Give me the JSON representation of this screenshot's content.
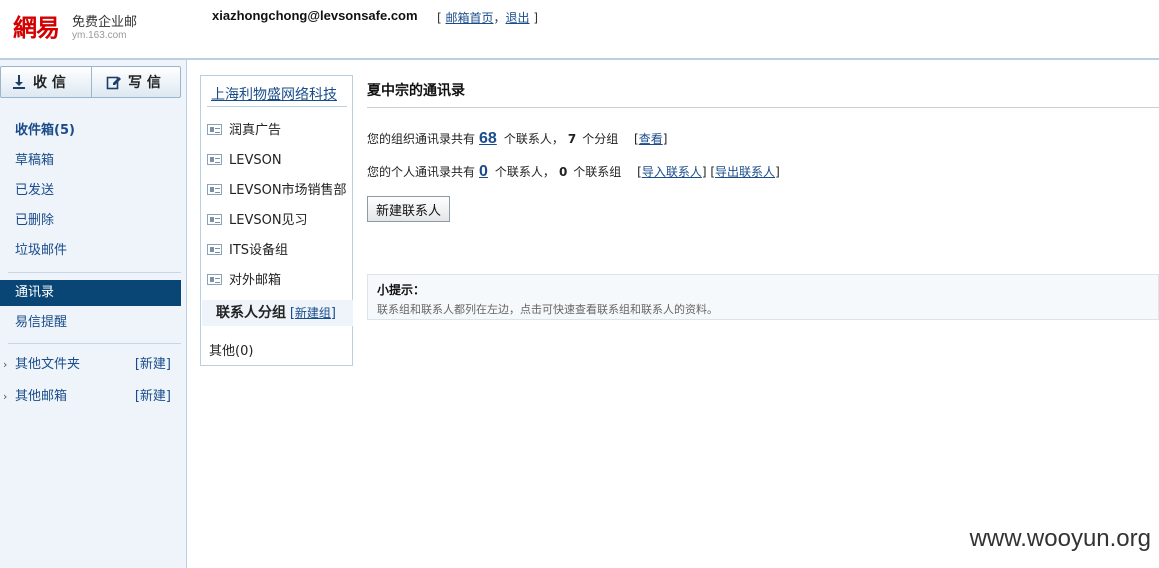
{
  "header": {
    "logo_glyph": "網易",
    "logo_name": "免费企业邮",
    "logo_domain": "ym.163.com",
    "account_email": "xiazhongchong@levsonsafe.com",
    "bracket_open": "[",
    "bracket_close": "]",
    "mail_home_link": "邮箱首页",
    "comma": "，",
    "logout_link": "退出"
  },
  "sidebar": {
    "receive_label": "收 信",
    "compose_label": "写 信",
    "inbox_label": "收件箱(5)",
    "drafts_label": "草稿箱",
    "sent_label": "已发送",
    "deleted_label": "已删除",
    "spam_label": "垃圾邮件",
    "contacts_label": "通讯录",
    "yixin_label": "易信提醒",
    "other_folders_label": "其他文件夹",
    "other_mailboxes_label": "其他邮箱",
    "new_label": "[新建]"
  },
  "groups_panel": {
    "company_title": "上海利物盛网络科技",
    "org_items": [
      "润真广告",
      "LEVSON",
      "LEVSON市场销售部",
      "LEVSON见习",
      "ITS设备组",
      "对外邮箱"
    ],
    "contact_groups_title": "联系人分组",
    "bracket_open": "[",
    "new_group_link": "新建组",
    "bracket_close": "]",
    "other_group": "其他(0)"
  },
  "main": {
    "title": "夏中宗的通讯录",
    "org_prefix": "您的组织通讯录共有",
    "org_count": "68",
    "org_unit": "个联系人，",
    "org_group_count": "7",
    "org_group_unit": "个分组",
    "view_link": "查看",
    "personal_prefix": "您的个人通讯录共有",
    "personal_count": "0",
    "personal_unit": "个联系人，",
    "personal_group_count": "0",
    "personal_group_unit": "个联系组",
    "import_link": "导入联系人",
    "export_link": "导出联系人",
    "new_contact_button": "新建联系人",
    "tip_title": "小提示：",
    "tip_text": "联系组和联系人都列在左边，点击可快速查看联系组和联系人的资料。"
  },
  "watermark": "www.wooyun.org",
  "colors": {
    "accent": "#0a4675",
    "link": "#1a4c8a",
    "logo_red": "#d40000",
    "sidebar_bg": "#eef4fa"
  }
}
